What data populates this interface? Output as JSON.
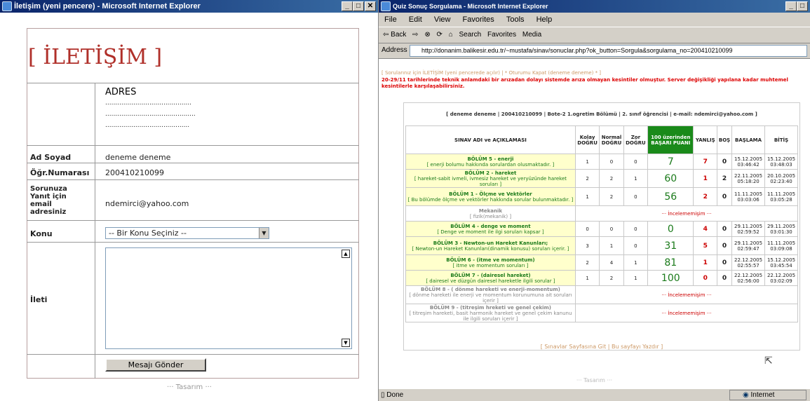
{
  "left": {
    "title": "İletişim (yeni pencere) - Microsoft Internet Explorer",
    "heading": "[ İLETİŞİM ]",
    "adres_label": "ADRES",
    "adres_lines": [
      "...........................................",
      ".............................................",
      ".........................................."
    ],
    "fields": {
      "ad_soyad_label": "Ad Soyad",
      "ad_soyad_value": "deneme deneme",
      "ogr_label": "Öğr.Numarası",
      "ogr_value": "200410210099",
      "yanit_label": "Sorunuza Yanıt için email adresiniz",
      "yanit_value": "ndemirci@yahoo.com",
      "konu_label": "Konu",
      "konu_value": "-- Bir Konu Seçiniz --",
      "ileti_label": "İleti"
    },
    "send_button": "Mesajı Gönder",
    "footer": "··· Tasarım ···"
  },
  "right": {
    "title": "Quiz Sonuç Sorgulama - Microsoft Internet Explorer",
    "menu": [
      "File",
      "Edit",
      "View",
      "Favorites",
      "Tools",
      "Help"
    ],
    "toolbar": [
      "⇦ Back",
      "⇨",
      "Search",
      "Favorites",
      "Media"
    ],
    "address_label": "Address",
    "address": "http://donanim.balikesir.edu.tr/~mustafa/sinav/sonuclar.php?ok_button=Sorgula&sorgulama_no=200410210099",
    "notice1": "[ Sorularınız için İLETİŞİM (yeni pencerede açılır) | * Oturumu Kapat (deneme deneme) * ]",
    "notice2": "20-29/11 tarihlerinde teknik anlamdaki bir arızadan dolayı sistemde arıza olmayan kesintiler olmuştur. Server değişikliği yapılana kadar muhtemel kesintilerle karşılaşabilirsiniz.",
    "student": "[ deneme deneme | 200410210099 | Bote-2 1.ogretim Bölümü | 2. sınıf öğrencisi | e-mail: ndemirci@yahoo.com ]",
    "headers": [
      "SINAV ADI ve AÇIKLAMASI",
      "Kolay DOĞRU",
      "Normal DOĞRU",
      "Zor DOĞRU",
      "100 üzerinden BAŞARI PUANI",
      "YANLIŞ",
      "BOŞ",
      "BAŞLAMA",
      "BİTİŞ"
    ],
    "rows": [
      {
        "name": "BÖLÜM 5 - enerji",
        "desc": "[ enerji bolumu hakkında sorulardan olusmaktadır. ]",
        "k": "1",
        "n": "0",
        "z": "0",
        "p": "7",
        "y": "7",
        "b": "0",
        "s": "15.12.2005 03:46:42",
        "e": "15.12.2005 03:48:03"
      },
      {
        "name": "BÖLÜM 2 - hareket",
        "desc": "[ hareket-sabit ivmeli, ivmesiz hareket ve yeryüzünde hareket soruları ]",
        "k": "2",
        "n": "2",
        "z": "1",
        "p": "60",
        "y": "1",
        "b": "2",
        "s": "22.11.2005 05:18:20",
        "e": "20.10.2005 02:23:40"
      },
      {
        "name": "BÖLÜM 1 - Ölçme ve Vektörler",
        "desc": "[ Bu bölümde ölçme ve vektörler hakkında sorular bulunmaktadır. ]",
        "k": "1",
        "n": "2",
        "z": "0",
        "p": "56",
        "y": "2",
        "b": "0",
        "s": "11.11.2005 03:03:06",
        "e": "11.11.2005 03:05:28"
      },
      {
        "name": "Mekanik",
        "desc": "[ fizik(mekanik) ]",
        "none": "··· İncelememişim ···"
      },
      {
        "name": "BÖLÜM 4 - denge ve moment",
        "desc": "[ Denge ve moment ile ilgi soruları kapsar ]",
        "k": "0",
        "n": "0",
        "z": "0",
        "p": "0",
        "y": "4",
        "b": "0",
        "s": "29.11.2005 02:59:52",
        "e": "29.11.2005 03:01:30"
      },
      {
        "name": "BÖLÜM 3 - Newton-un Hareket Kanunları;",
        "desc": "[ Newton-un Hareket Kanunları(dinamik konusu) soruları içerir. ]",
        "k": "3",
        "n": "1",
        "z": "0",
        "p": "31",
        "y": "5",
        "b": "0",
        "s": "29.11.2005 02:59:47",
        "e": "11.11.2005 03:09:08"
      },
      {
        "name": "BÖLÜM 6 - (itme ve momentum)",
        "desc": "[ itme ve momentum soruları ]",
        "k": "2",
        "n": "4",
        "z": "1",
        "p": "81",
        "y": "1",
        "b": "0",
        "s": "22.12.2005 02:55:57",
        "e": "15.12.2005 03:45:54"
      },
      {
        "name": "BÖLÜM 7 - (dairesel hareket)",
        "desc": "[ dairesel ve düzgün dairesel hareketle ilgili sorular ]",
        "k": "1",
        "n": "2",
        "z": "1",
        "p": "100",
        "y": "0",
        "b": "0",
        "s": "22.12.2005 02:56:00",
        "e": "22.12.2005 03:02:09"
      },
      {
        "name": "BÖLÜM 8 - ( dönme hareketi ve enerji-momentum)",
        "desc": "[ dönme hareketi ile enerji ve momentum korunumuna ait soruları içerir ]",
        "none": "··· İncelememişim ···"
      },
      {
        "name": "BÖLÜM 9 - (titreşim hreketi ve genel çekim)",
        "desc": "[ titreşim hareketi, basit harmonik hareket ve genel çekim kanunu ile ilgili soruları içerir ]",
        "none": "··· İncelememişim ···"
      }
    ],
    "bottom_links": "[ Sınavlar Sayfasına Git | Bu sayfayı Yazdır ]",
    "footer": "··· Tasarım ···",
    "status_left": "Done",
    "status_right": "Internet"
  }
}
